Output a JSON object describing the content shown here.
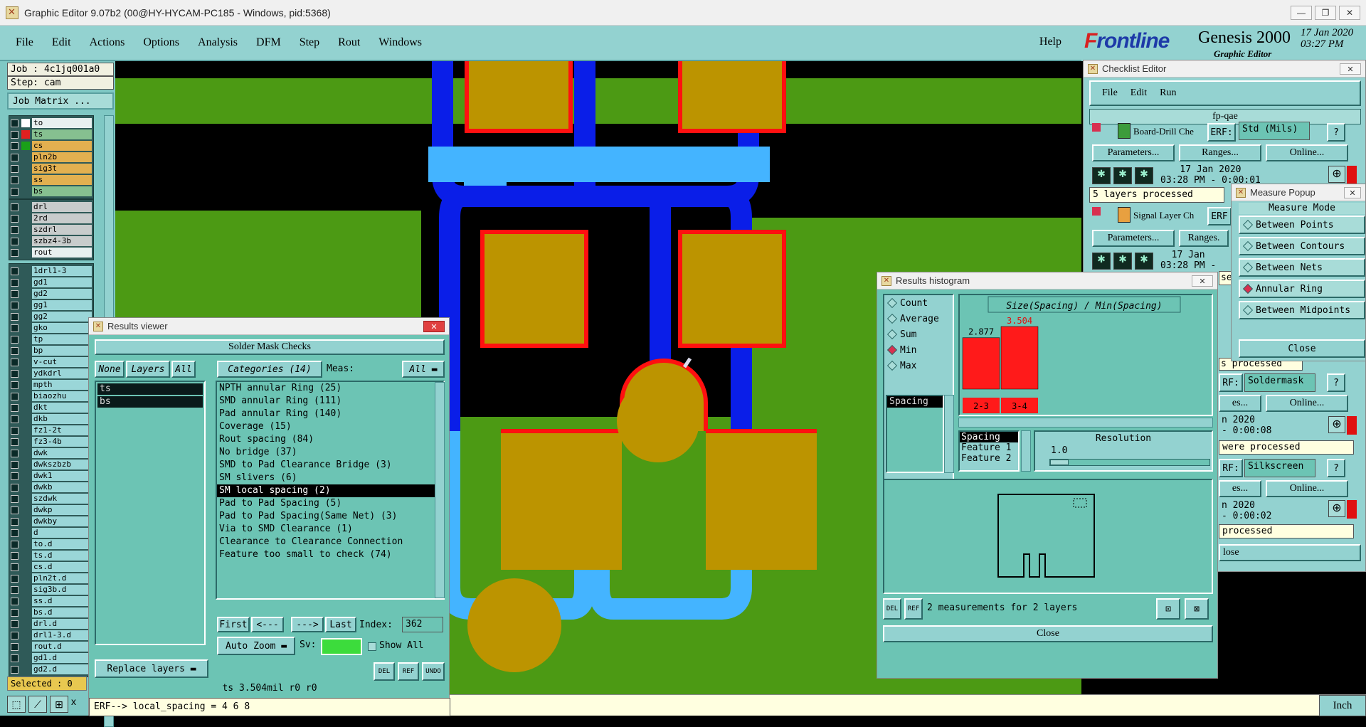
{
  "os_window": {
    "title": "Graphic Editor 9.07b2 (00@HY-HYCAM-PC185 - Windows, pid:5368)",
    "buttons": [
      "—",
      "❐",
      "✕"
    ]
  },
  "menu": {
    "items": [
      "File",
      "Edit",
      "Actions",
      "Options",
      "Analysis",
      "DFM",
      "Step",
      "Rout",
      "Windows"
    ],
    "help": "Help"
  },
  "brand": {
    "logo_f": "F",
    "logo_rest": "rontline",
    "product": "Genesis 2000",
    "subtitle": "Graphic Editor",
    "date": "17 Jan 2020",
    "time": "03:27 PM"
  },
  "left_panel": {
    "job": "Job : 4c1jq001a0",
    "step": "Step: cam",
    "job_matrix": "Job Matrix ...",
    "groups": [
      {
        "layers": [
          {
            "name": "to",
            "swatch": "#ffffff",
            "style": "white"
          },
          {
            "name": "ts",
            "swatch": "#e02020",
            "style": "green"
          },
          {
            "name": "cs",
            "swatch": "#1aa018",
            "style": "orange"
          },
          {
            "name": "pln2b",
            "swatch": "",
            "style": "orange"
          },
          {
            "name": "sig3t",
            "swatch": "",
            "style": "orange"
          },
          {
            "name": "ss",
            "swatch": "",
            "style": "orange"
          },
          {
            "name": "bs",
            "swatch": "",
            "style": "green"
          }
        ]
      },
      {
        "layers": [
          {
            "name": "drl",
            "swatch": "",
            "style": "gray"
          },
          {
            "name": "2rd",
            "swatch": "",
            "style": "gray"
          },
          {
            "name": "szdrl",
            "swatch": "",
            "style": "gray"
          },
          {
            "name": "szbz4-3b",
            "swatch": "",
            "style": "gray"
          },
          {
            "name": "rout",
            "swatch": "",
            "style": "white"
          }
        ]
      },
      {
        "layers": [
          {
            "name": "1drl1-3",
            "swatch": "",
            "style": "blue"
          },
          {
            "name": "gd1",
            "swatch": "",
            "style": "blue"
          },
          {
            "name": "gd2",
            "swatch": "",
            "style": "blue"
          },
          {
            "name": "gg1",
            "swatch": "",
            "style": "blue"
          },
          {
            "name": "gg2",
            "swatch": "",
            "style": "blue"
          },
          {
            "name": "gko",
            "swatch": "",
            "style": "blue"
          },
          {
            "name": "tp",
            "swatch": "",
            "style": "blue"
          },
          {
            "name": "bp",
            "swatch": "",
            "style": "blue"
          },
          {
            "name": "v-cut",
            "swatch": "",
            "style": "blue"
          },
          {
            "name": "ydkdrl",
            "swatch": "",
            "style": "blue"
          },
          {
            "name": "mpth",
            "swatch": "",
            "style": "blue"
          },
          {
            "name": "biaozhu",
            "swatch": "",
            "style": "blue"
          },
          {
            "name": "dkt",
            "swatch": "",
            "style": "blue"
          },
          {
            "name": "dkb",
            "swatch": "",
            "style": "blue"
          },
          {
            "name": "fz1-2t",
            "swatch": "",
            "style": "blue"
          },
          {
            "name": "fz3-4b",
            "swatch": "",
            "style": "blue"
          },
          {
            "name": "dwk",
            "swatch": "",
            "style": "blue"
          },
          {
            "name": "dwkszbzb",
            "swatch": "",
            "style": "blue"
          },
          {
            "name": "dwk1",
            "swatch": "",
            "style": "blue"
          },
          {
            "name": "dwkb",
            "swatch": "",
            "style": "blue"
          },
          {
            "name": "szdwk",
            "swatch": "",
            "style": "blue"
          },
          {
            "name": "dwkp",
            "swatch": "",
            "style": "blue"
          },
          {
            "name": "dwkby",
            "swatch": "",
            "style": "blue"
          },
          {
            "name": "d",
            "swatch": "",
            "style": "blue"
          },
          {
            "name": "to.d",
            "swatch": "",
            "style": "blue"
          },
          {
            "name": "ts.d",
            "swatch": "",
            "style": "blue"
          },
          {
            "name": "cs.d",
            "swatch": "",
            "style": "blue"
          },
          {
            "name": "pln2t.d",
            "swatch": "",
            "style": "blue"
          },
          {
            "name": "sig3b.d",
            "swatch": "",
            "style": "blue"
          },
          {
            "name": "ss.d",
            "swatch": "",
            "style": "blue"
          },
          {
            "name": "bs.d",
            "swatch": "",
            "style": "blue"
          },
          {
            "name": "drl.d",
            "swatch": "",
            "style": "blue"
          },
          {
            "name": "drl1-3.d",
            "swatch": "",
            "style": "blue"
          },
          {
            "name": "rout.d",
            "swatch": "",
            "style": "blue"
          },
          {
            "name": "gd1.d",
            "swatch": "",
            "style": "blue"
          },
          {
            "name": "gd2.d",
            "swatch": "",
            "style": "blue"
          }
        ]
      }
    ],
    "selected": "Selected : 0"
  },
  "status": {
    "unit": "Inch",
    "x_label": "x"
  },
  "results_viewer": {
    "title": "Results viewer",
    "header": "Solder Mask Checks",
    "none_btn": "None",
    "layers_btn": "Layers",
    "all_btn": "All",
    "categories_label": "Categories (14)",
    "meas_label": "Meas:",
    "meas_value": "All",
    "selected_layers": [
      "ts",
      "bs"
    ],
    "categories": [
      "NPTH annular Ring (25)",
      "SMD annular Ring (111)",
      "Pad annular Ring (140)",
      "Coverage (15)",
      "Rout spacing (84)",
      "No bridge (37)",
      "SMD to Pad Clearance Bridge (3)",
      "SM slivers (6)",
      "SM local spacing (2)",
      "Pad to Pad Spacing (5)",
      "Pad to Pad Spacing(Same Net) (3)",
      "Via to SMD Clearance (1)",
      "Clearance to Clearance Connection",
      "Feature too small to check (74)"
    ],
    "selected_category_index": 8,
    "nav": {
      "first": "First",
      "prev": "<---",
      "next": "--->",
      "last": "Last",
      "index_label": "Index:",
      "index_value": "362"
    },
    "auto_zoom": "Auto Zoom",
    "sv_label": "Sv:",
    "show_all": "Show All",
    "replace_layers": "Replace layers",
    "del": "DEL",
    "ref": "REF",
    "undo": "UNDO",
    "measure_line": "ts 3.504mil  r0  r0",
    "erf_line": "ERF--> local_spacing = 4 6 8"
  },
  "checklist": {
    "title": "Checklist Editor",
    "menu": [
      "File",
      "Edit",
      "Run"
    ],
    "name": "fp-qae",
    "check1": {
      "name": "Board-Drill Che",
      "erf": "ERF:",
      "erf_value": "Std (Mils)",
      "params": "Parameters...",
      "ranges": "Ranges...",
      "online": "Online...",
      "date": "17 Jan 2020",
      "time": "03:28 PM - 0:00:01",
      "status": "5 layers processed"
    },
    "check2": {
      "name": "Signal Layer Ch",
      "erf": "ERF",
      "params": "Parameters...",
      "ranges": "Ranges.",
      "date": "17 Jan",
      "time": "03:28 PM -",
      "status_partial": "se"
    },
    "check3": {
      "status_partial": "s processed",
      "erf": "RF:",
      "erf_value": "Soldermask",
      "ranges": "es...",
      "online": "Online...",
      "date": "n 2020",
      "time": "- 0:00:08",
      "status": "were processed"
    },
    "check4": {
      "erf": "RF:",
      "erf_value": "Silkscreen",
      "ranges": "es...",
      "online": "Online...",
      "date": "n 2020",
      "time": "- 0:00:02",
      "status": "processed"
    },
    "close_partial": "lose",
    "help": "?"
  },
  "measure_popup": {
    "title": "Measure Popup",
    "header": "Measure Mode",
    "modes": [
      "Between Points",
      "Between Contours",
      "Between Nets",
      "Annular Ring",
      "Between Midpoints"
    ],
    "selected_index": 3,
    "close": "Close"
  },
  "histogram": {
    "title": "Results histogram",
    "options": [
      "Count",
      "Average",
      "Sum",
      "Min",
      "Max"
    ],
    "selected_option_index": 3,
    "category_list": [
      "Spacing"
    ],
    "chart_title": "Size(Spacing) / Min(Spacing)",
    "attr_list": [
      "Spacing",
      "Feature 1",
      "Feature 2"
    ],
    "resolution_label": "Resolution",
    "resolution_value": "1.0",
    "summary": "2 measurements for 2 layers",
    "close": "Close",
    "del": "DEL",
    "ref": "REF",
    "colors": {
      "bar": "#ff1a1a",
      "selected_value": "#e01010"
    }
  },
  "chart_data": {
    "type": "bar",
    "categories": [
      "2-3",
      "3-4"
    ],
    "values": [
      2.877,
      3.504
    ],
    "value_labels": [
      "2.877",
      "3.504"
    ],
    "title": "Size(Spacing) / Min(Spacing)"
  },
  "colors": {
    "panel": "#6cc4b4",
    "panel_light": "#93d2d0",
    "canvas_green": "#4c9a14",
    "pad_gold": "#bc9400",
    "mask_blue": "#0a1ee8",
    "mask_light_blue": "#44b4ff",
    "outline_red": "#ff1010"
  }
}
